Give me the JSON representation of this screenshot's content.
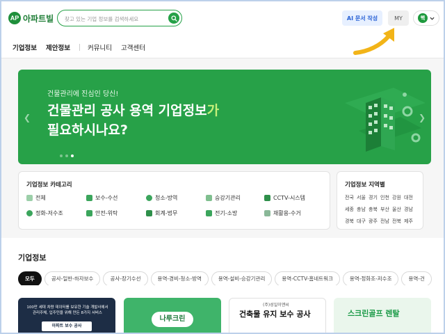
{
  "header": {
    "logo_mark": "AP",
    "logo_text": "아파트빌",
    "search_placeholder": "찾고 있는 기업 정보를 검색하세요",
    "ai_button": "AI 문서 작성",
    "my_button": "MY",
    "avatar_initial": "핵"
  },
  "nav": {
    "items": [
      "기업정보",
      "제안정보",
      "커뮤니티",
      "고객센터"
    ]
  },
  "banner": {
    "subtitle": "건물관리에 진심인 당신!",
    "title_line1": "건물관리 공사 용역 기업정보",
    "title_line1_highlight": "가",
    "title_line2": "필요하시나요?",
    "slide_count": 3,
    "active_slide": 3
  },
  "category": {
    "title": "기업정보 카테고리",
    "items": [
      {
        "label": "전체",
        "color": "#3ba55c"
      },
      {
        "label": "보수-수선",
        "color": "#3ba55c"
      },
      {
        "label": "청소-방역",
        "color": "#3ba55c"
      },
      {
        "label": "승강기관리",
        "color": "#3ba55c"
      },
      {
        "label": "CCTV-시스템",
        "color": "#3ba55c"
      },
      {
        "label": "정화-저수조",
        "color": "#3ba55c"
      },
      {
        "label": "안전-위탁",
        "color": "#3ba55c"
      },
      {
        "label": "회계-법무",
        "color": "#3ba55c"
      },
      {
        "label": "전기-소방",
        "color": "#3ba55c"
      },
      {
        "label": "재활용-수거",
        "color": "#3ba55c"
      }
    ]
  },
  "region": {
    "title": "기업정보 지역별",
    "items": [
      "전국",
      "서울",
      "경기",
      "인천",
      "강원",
      "대전",
      "세종",
      "충남",
      "충북",
      "부산",
      "울산",
      "경남",
      "경북",
      "대구",
      "광주",
      "전남",
      "전북",
      "제주"
    ]
  },
  "company_info": {
    "title": "기업정보",
    "chips": [
      "모두",
      "공사-일반-하자보수",
      "공사-장기수선",
      "용역-경비-청소-방역",
      "용역-설비-승강기관리",
      "용역-CCTV-홈네트워크",
      "용역-정화조-저수조",
      "용역-건"
    ],
    "active_chip": 0,
    "cards": [
      {
        "text": "100만 세대 차량 데이터를 보유한 기술 개발사에서 관리주체, 입주민을 위해 만든 8가지 서비스",
        "button": "아파트 보수 공사"
      },
      {
        "text": "나루크린"
      },
      {
        "logo": "(주)성일이앤씨",
        "text": "건축물 유지 보수 공사"
      },
      {
        "text": "스크린골프 렌탈"
      }
    ]
  },
  "colors": {
    "brand_green": "#27a148",
    "ai_blue": "#2a63d6",
    "arrow_yellow": "#f2b418"
  }
}
